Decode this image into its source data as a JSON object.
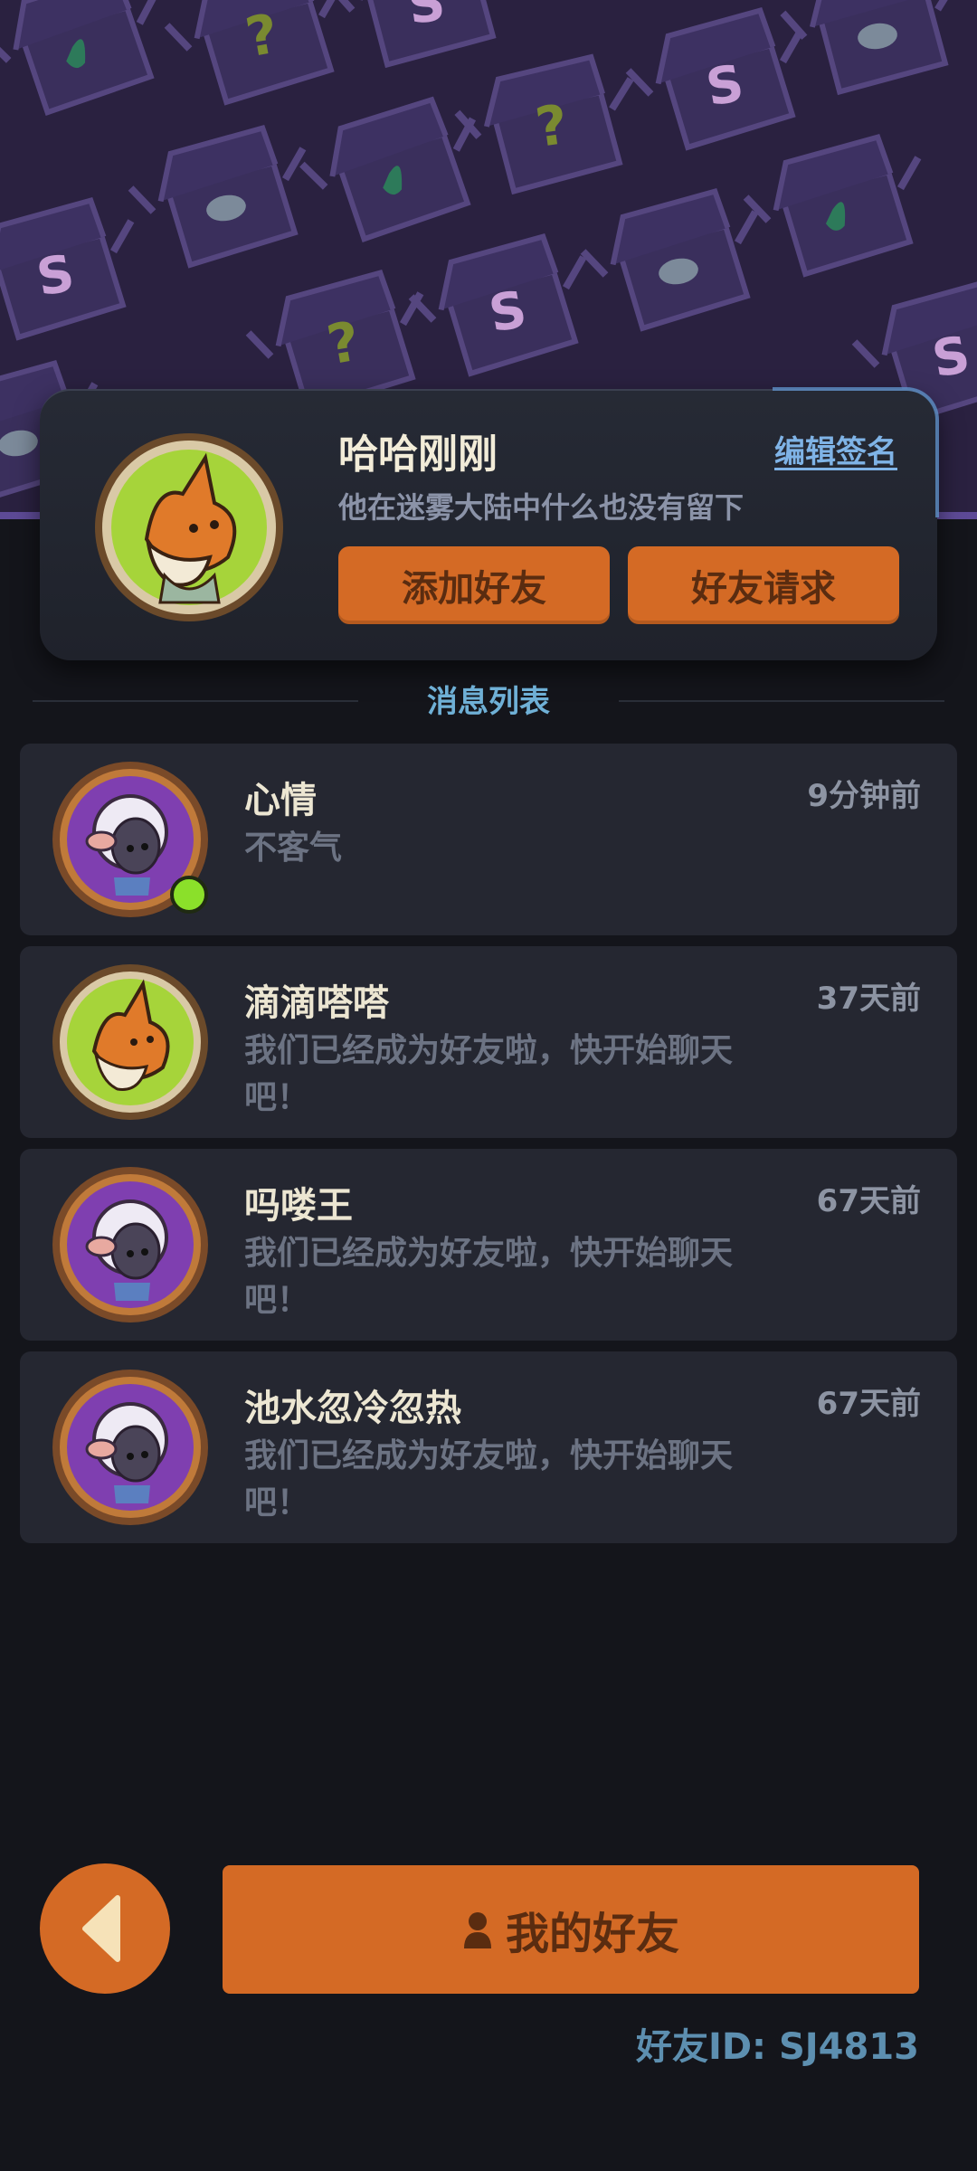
{
  "profile": {
    "name": "哈哈刚刚",
    "edit_label": "编辑签名",
    "signature": "他在迷雾大陆中什么也没有留下",
    "add_friend_label": "添加好友",
    "friend_request_label": "好友请求",
    "avatar": "fox-avatar-icon"
  },
  "section_title": "消息列表",
  "messages": [
    {
      "name": "心情",
      "text": "不客气",
      "time": "9分钟前",
      "avatar": "sheep-avatar-icon",
      "online": true
    },
    {
      "name": "滴滴嗒嗒",
      "text": "我们已经成为好友啦，快开始聊天吧！",
      "time": "37天前",
      "avatar": "fox-avatar-icon",
      "online": false
    },
    {
      "name": "吗喽王",
      "text": "我们已经成为好友啦，快开始聊天吧！",
      "time": "67天前",
      "avatar": "sheep-avatar-icon",
      "online": false
    },
    {
      "name": "池水忽冷忽热",
      "text": "我们已经成为好友啦，快开始聊天吧！",
      "time": "67天前",
      "avatar": "sheep-avatar-icon",
      "online": false
    }
  ],
  "bottom": {
    "my_friends_label": "我的好友",
    "friend_id": "好友ID: SJ4813"
  },
  "colors": {
    "accent": "#d46a25",
    "background": "#14151b",
    "banner": "#2a2140",
    "online": "#8be02a"
  }
}
